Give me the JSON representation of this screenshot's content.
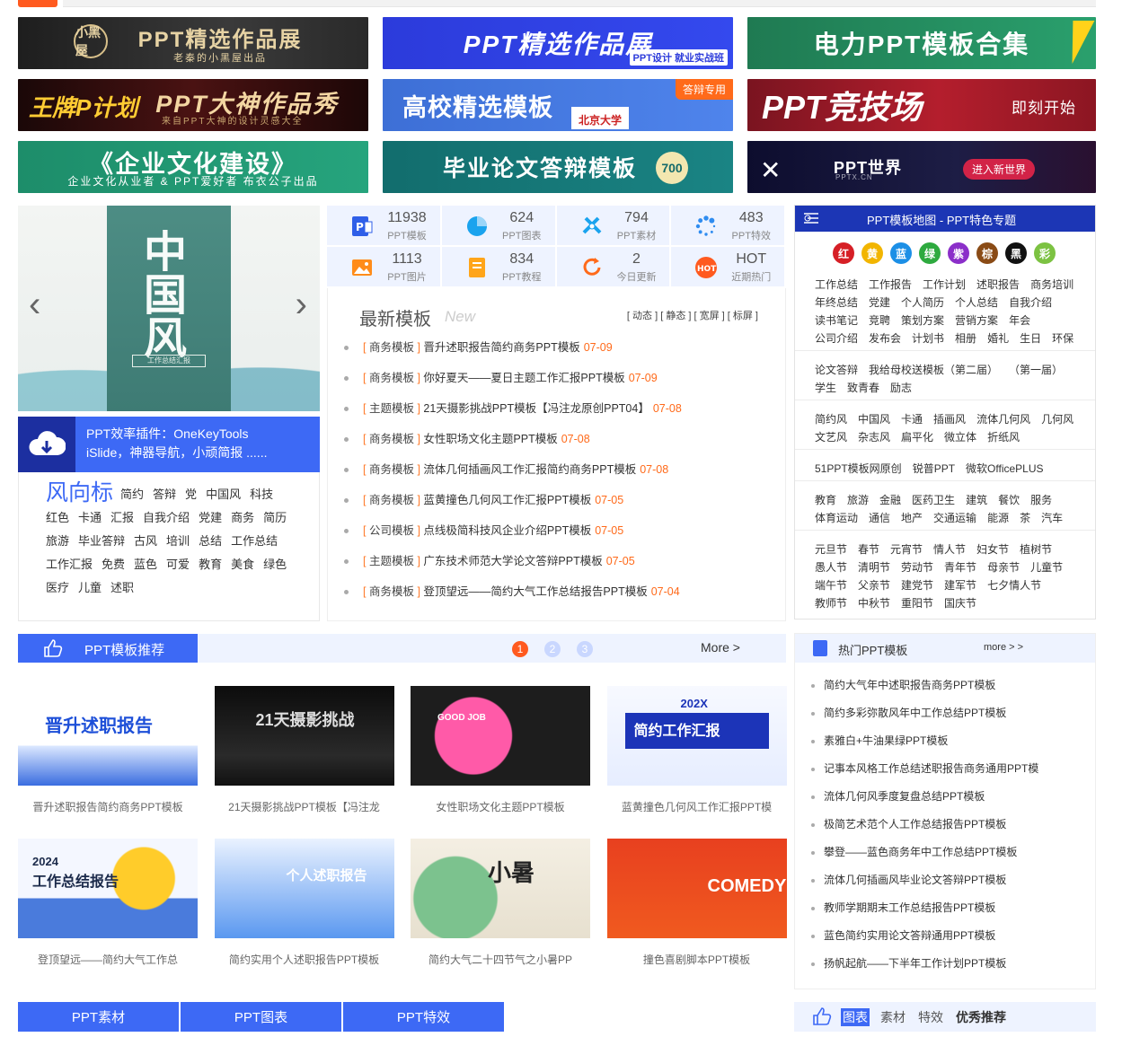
{
  "banners": [
    {
      "title": "PPT精选作品展",
      "sub": "老秦的小黑屋出品",
      "seal": "小黑屋"
    },
    {
      "title": "PPT精选作品展",
      "tag": "PPT设计 就业实战班"
    },
    {
      "title": "电力PPT模板合集"
    },
    {
      "title": "PPT大神作品秀",
      "logo": "王牌P计划",
      "sub": "来自PPT大神的设计灵感大全"
    },
    {
      "title": "高校精选模板",
      "ribbon": "答辩专用",
      "sub": "北京大学"
    },
    {
      "title": "PPT竞技场",
      "cta": "即刻开始"
    },
    {
      "title": "《企业文化建设》",
      "sub": "企业文化从业者 & PPT爱好者 布衣公子出品"
    },
    {
      "title": "毕业论文答辩模板",
      "badge": "700"
    },
    {
      "title": "PPT世界",
      "small": "PPTX.CN",
      "cta": "进入新世界"
    }
  ],
  "slider": {
    "title": "中国风",
    "subtitle": "工作总结汇报",
    "prev": "‹",
    "next": "›"
  },
  "plugin": {
    "line1": "PPT效率插件：OneKeyTools",
    "line2": "iSlide，神器导航，小顽简报 ......"
  },
  "wind": {
    "head": "风向标",
    "tags": [
      "简约",
      "答辩",
      "党",
      "中国风",
      "科技",
      "红色",
      "卡通",
      "汇报",
      "自我介绍",
      "党建",
      "商务",
      "简历",
      "旅游",
      "毕业答辩",
      "古风",
      "培训",
      "总结",
      "工作总结",
      "工作汇报",
      "免费",
      "蓝色",
      "可爱",
      "教育",
      "美食",
      "绿色",
      "医疗",
      "儿童",
      "述职"
    ]
  },
  "stats": [
    {
      "num": "11938",
      "label": "PPT模板",
      "icon": "ppt-doc-icon",
      "color": "#2f5fe8"
    },
    {
      "num": "624",
      "label": "PPT图表",
      "icon": "pie-chart-icon",
      "color": "#1aa3ee"
    },
    {
      "num": "794",
      "label": "PPT素材",
      "icon": "tools-icon",
      "color": "#1aa3ee"
    },
    {
      "num": "483",
      "label": "PPT特效",
      "icon": "spinner-icon",
      "color": "#2f8cf0"
    },
    {
      "num": "1113",
      "label": "PPT图片",
      "icon": "image-icon",
      "color": "#ff8c1a"
    },
    {
      "num": "834",
      "label": "PPT教程",
      "icon": "book-icon",
      "color": "#ffa51a"
    },
    {
      "num": "2",
      "label": "今日更新",
      "icon": "refresh-icon",
      "color": "#ff6a1a"
    },
    {
      "num": "HOT",
      "label": "近期热门",
      "icon": "hot-icon",
      "color": "#ff5a1f"
    }
  ],
  "latest": {
    "title": "最新模板",
    "en": "New",
    "filters": "[ 动态 ] [ 静态 ] [ 宽屏 ] [ 标屏 ]",
    "items": [
      {
        "cat": "商务模板",
        "name": "晋升述职报告简约商务PPT模板",
        "date": "07-09"
      },
      {
        "cat": "商务模板",
        "name": "你好夏天——夏日主题工作汇报PPT模板",
        "date": "07-09"
      },
      {
        "cat": "主题模板",
        "name": "21天摄影挑战PPT模板【冯注龙原创PPT04】",
        "date": "07-08"
      },
      {
        "cat": "商务模板",
        "name": "女性职场文化主题PPT模板",
        "date": "07-08"
      },
      {
        "cat": "商务模板",
        "name": "流体几何插画风工作汇报简约商务PPT模板",
        "date": "07-08"
      },
      {
        "cat": "商务模板",
        "name": "蓝黄撞色几何风工作汇报PPT模板",
        "date": "07-05"
      },
      {
        "cat": "公司模板",
        "name": "点线极简科技风企业介绍PPT模板",
        "date": "07-05"
      },
      {
        "cat": "主题模板",
        "name": "广东技术师范大学论文答辩PPT模板",
        "date": "07-05"
      },
      {
        "cat": "商务模板",
        "name": "登顶望远——简约大气工作总结报告PPT模板",
        "date": "07-04"
      }
    ]
  },
  "map": {
    "title": "PPT模板地图 - PPT特色专题",
    "colors": [
      {
        "t": "红",
        "c": "#d61f26"
      },
      {
        "t": "黄",
        "c": "#f2b500"
      },
      {
        "t": "蓝",
        "c": "#1c8fe6"
      },
      {
        "t": "绿",
        "c": "#2eaa3f"
      },
      {
        "t": "紫",
        "c": "#8b2fc9"
      },
      {
        "t": "棕",
        "c": "#8a4b16"
      },
      {
        "t": "黑",
        "c": "#111111"
      },
      {
        "t": "彩",
        "c": "#7cc242"
      }
    ],
    "groups": [
      [
        "工作总结",
        "工作报告",
        "工作计划",
        "述职报告",
        "商务培训",
        "年终总结",
        "党建",
        "个人简历",
        "个人总结",
        "自我介绍",
        "读书笔记",
        "竞聘",
        "策划方案",
        "营销方案",
        "年会",
        "公司介绍",
        "发布会",
        "计划书",
        "相册",
        "婚礼",
        "生日",
        "环保"
      ],
      [
        "论文答辩",
        "我给母校送模板（第二届）",
        "（第一届）",
        "学生",
        "致青春",
        "励志"
      ],
      [
        "简约风",
        "中国风",
        "卡通",
        "插画风",
        "流体几何风",
        "几何风",
        "文艺风",
        "杂志风",
        "扁平化",
        "微立体",
        "折纸风"
      ],
      [
        "51PPT模板网原创",
        "锐普PPT",
        "微软OfficePLUS"
      ],
      [
        "教育",
        "旅游",
        "金融",
        "医药卫生",
        "建筑",
        "餐饮",
        "服务",
        "体育运动",
        "通信",
        "地产",
        "交通运输",
        "能源",
        "茶",
        "汽车"
      ],
      [
        "元旦节",
        "春节",
        "元宵节",
        "情人节",
        "妇女节",
        "植树节",
        "愚人节",
        "清明节",
        "劳动节",
        "青年节",
        "母亲节",
        "儿童节",
        "端午节",
        "父亲节",
        "建党节",
        "建军节",
        "七夕情人节",
        "教师节",
        "中秋节",
        "重阳节",
        "国庆节"
      ]
    ]
  },
  "recommend": {
    "title": "PPT模板推荐",
    "pages": [
      "1",
      "2",
      "3"
    ],
    "more": "More >",
    "items": [
      {
        "cap": "晋升述职报告简约商务PPT模板",
        "thumb": "晋升述职报告"
      },
      {
        "cap": "21天摄影挑战PPT模板【冯注龙",
        "thumb": "21天摄影挑战"
      },
      {
        "cap": "女性职场文化主题PPT模板",
        "thumb": "GOOD JOB"
      },
      {
        "cap": "蓝黄撞色几何风工作汇报PPT模",
        "thumb": "简约工作汇报",
        "thumb2": "202X"
      },
      {
        "cap": "登顶望远——简约大气工作总",
        "thumb": "工作总结报告",
        "thumb2": "2024"
      },
      {
        "cap": "简约实用个人述职报告PPT模板",
        "thumb": "个人述职报告"
      },
      {
        "cap": "简约大气二十四节气之小暑PP",
        "thumb": "小暑"
      },
      {
        "cap": "撞色喜剧脚本PPT模板",
        "thumb": "COMEDY"
      }
    ]
  },
  "hot": {
    "title": "热门PPT模板",
    "more": "more > >",
    "items": [
      "简约大气年中述职报告商务PPT模板",
      "简约多彩弥散风年中工作总结PPT模板",
      "素雅白+牛油果绿PPT模板",
      "记事本风格工作总结述职报告商务通用PPT模",
      "流体几何风季度复盘总结PPT模板",
      "极简艺术范个人工作总结报告PPT模板",
      "攀登——蓝色商务年中工作总结PPT模板",
      "流体几何插画风毕业论文答辩PPT模板",
      "教师学期期末工作总结报告PPT模板",
      "蓝色简约实用论文答辩通用PPT模板",
      "扬帆起航——下半年工作计划PPT模板"
    ]
  },
  "bottomTabs": [
    "PPT素材",
    "PPT图表",
    "PPT特效"
  ],
  "bottomRight": {
    "items": [
      "图表",
      "素材",
      "特效",
      "优秀推荐"
    ]
  }
}
